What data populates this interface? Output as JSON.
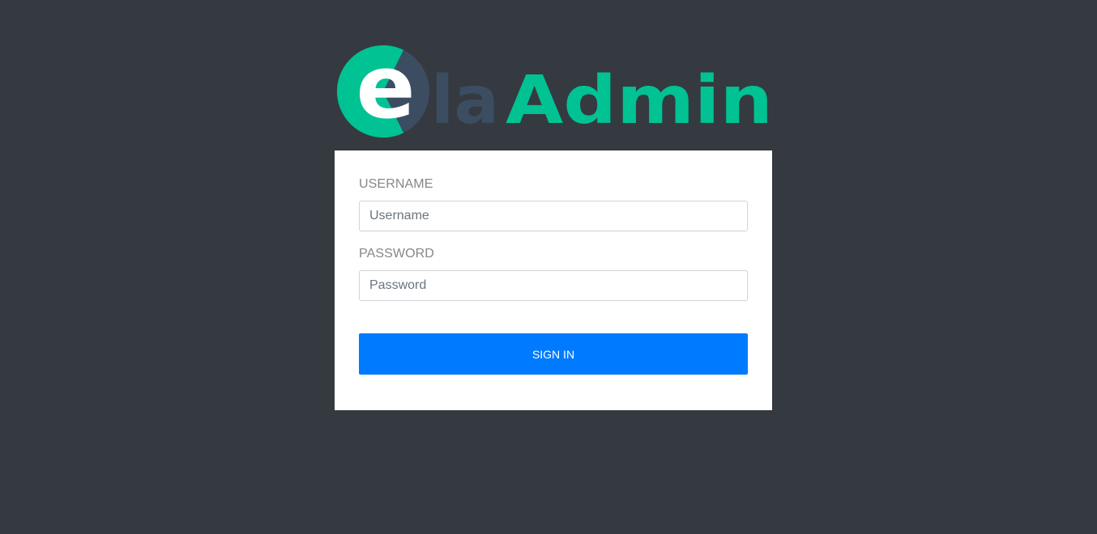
{
  "logo": {
    "letter_e": "e",
    "text_la": "la",
    "text_admin": "Admin",
    "color_green": "#00c292",
    "color_slate": "#3c4d62"
  },
  "form": {
    "username_label": "USERNAME",
    "username_placeholder": "Username",
    "username_value": "",
    "password_label": "PASSWORD",
    "password_placeholder": "Password",
    "password_value": "",
    "signin_label": "SIGN IN"
  },
  "colors": {
    "background": "#343a40",
    "card": "#ffffff",
    "primary": "#007bff"
  }
}
